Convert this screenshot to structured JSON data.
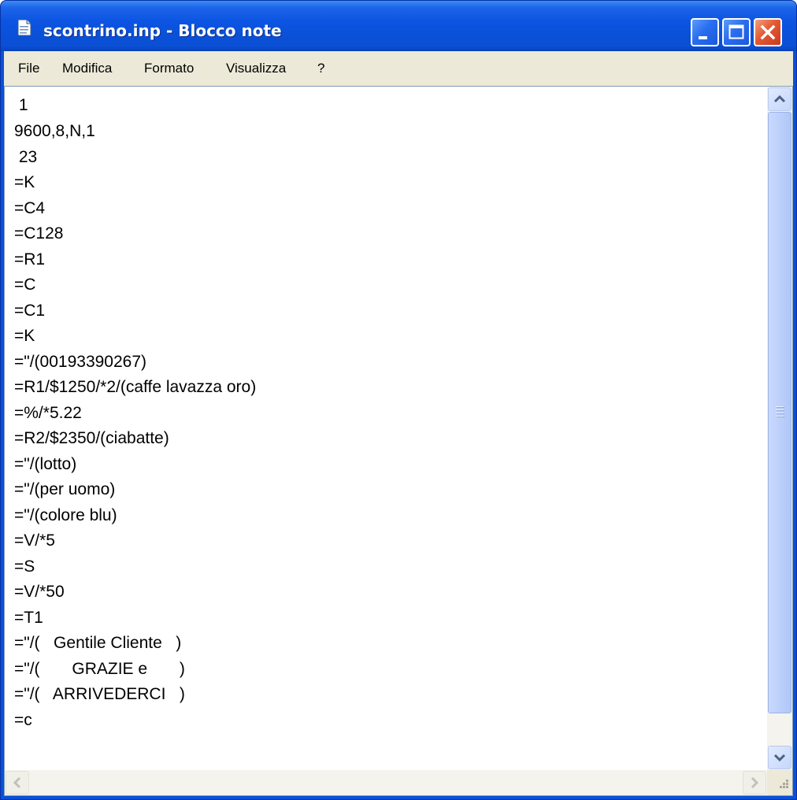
{
  "window": {
    "title": "scontrino.inp - Blocco note"
  },
  "menu": {
    "items": [
      "File",
      "Modifica",
      "Formato",
      "Visualizza",
      "?"
    ]
  },
  "editor": {
    "lines": [
      " 1",
      "9600,8,N,1",
      " 23",
      "=K",
      "=C4",
      "=C128",
      "=R1",
      "=C",
      "=C1",
      "=K",
      "=\"/(00193390267)",
      "=R1/$1250/*2/(caffe lavazza oro)",
      "=%/*5.22",
      "=R2/$2350/(ciabatte)",
      "=\"/(lotto)",
      "=\"/(per uomo)",
      "=\"/(colore blu)",
      "=V/*5",
      "=S",
      "=V/*50",
      "=T1",
      "=\"/(   Gentile Cliente   )",
      "=\"/(       GRAZIE e       )",
      "=\"/(   ARRIVEDERCI   )",
      "=c"
    ]
  },
  "icons": {
    "app": "notepad-icon",
    "minimize": "minimize-icon",
    "maximize": "maximize-icon",
    "close": "close-icon",
    "scroll_up": "arrow-up-icon",
    "scroll_down": "arrow-down-icon",
    "scroll_left": "arrow-left-icon",
    "scroll_right": "arrow-right-icon"
  },
  "colors": {
    "titlebar": "#0a50d8",
    "close_button": "#e35a33",
    "menubar": "#ece9d8"
  }
}
